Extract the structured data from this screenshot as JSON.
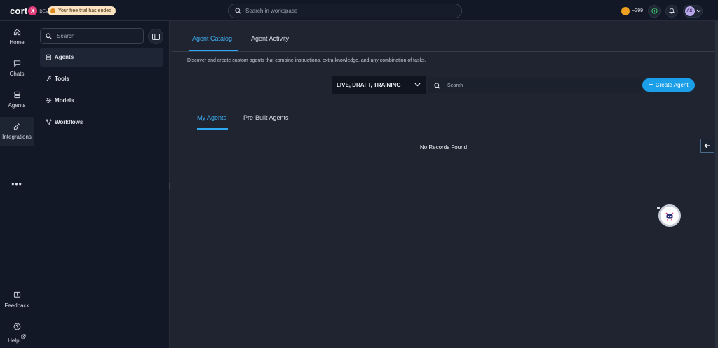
{
  "app": {
    "logo_text": "cort",
    "logo_mark": "x",
    "env_label": "DEV",
    "trial_notice": "Your free trial has ended"
  },
  "topbar": {
    "search_placeholder": "Search in workspace",
    "credits": "~299",
    "avatar_initials": "AS"
  },
  "rail": {
    "items": [
      {
        "label": "Home",
        "icon": "home-icon"
      },
      {
        "label": "Chats",
        "icon": "chat-icon"
      },
      {
        "label": "Agents",
        "icon": "agents-icon"
      },
      {
        "label": "Integrations",
        "icon": "plug-icon"
      }
    ],
    "more": "•••",
    "feedback": "Feedback",
    "help": "Help"
  },
  "subnav": {
    "search_placeholder": "Search",
    "items": [
      {
        "label": "Agents",
        "icon": "agents-icon",
        "active": true
      },
      {
        "label": "Tools",
        "icon": "wrench-icon",
        "active": false
      },
      {
        "label": "Models",
        "icon": "models-icon",
        "active": false
      },
      {
        "label": "Workflows",
        "icon": "workflow-icon",
        "active": false
      }
    ]
  },
  "main": {
    "tabs": [
      {
        "label": "Agent Catalog",
        "active": true
      },
      {
        "label": "Agent Activity",
        "active": false
      }
    ],
    "description": "Discover and create custom agents that combine instructions, extra knowledge, and any combination of tasks.",
    "status_filter": "LIVE, DRAFT, TRAINING",
    "search_placeholder": "Search",
    "create_button": "Create Agent",
    "subtabs": [
      {
        "label": "My Agents",
        "active": true
      },
      {
        "label": "Pre-Built Agents",
        "active": false
      }
    ],
    "empty_message": "No Records Found"
  },
  "colors": {
    "accent": "#1a9fe8",
    "tab_active": "#3fb1f5",
    "background": "#1f2430",
    "sidebar": "#121826",
    "trial_badge": "#fbe2c0"
  }
}
